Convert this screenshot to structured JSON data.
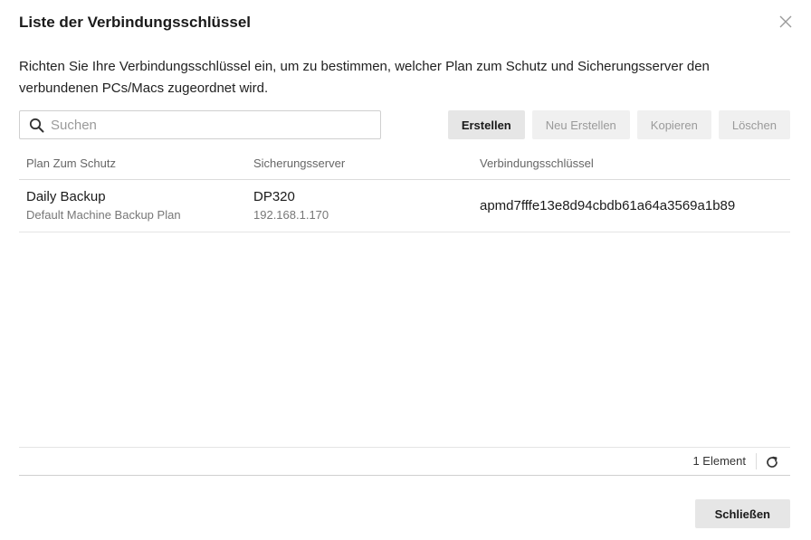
{
  "dialog": {
    "title": "Liste der Verbindungsschlüssel",
    "description": "Richten Sie Ihre Verbindungsschlüssel ein, um zu bestimmen, welcher Plan zum Schutz und Sicherungsserver den verbundenen PCs/Macs zugeordnet wird.",
    "close_icon": "close-icon"
  },
  "search": {
    "placeholder": "Suchen",
    "value": "",
    "icon": "search-icon"
  },
  "toolbar": {
    "create_label": "Erstellen",
    "recreate_label": "Neu Erstellen",
    "copy_label": "Kopieren",
    "delete_label": "Löschen"
  },
  "table": {
    "columns": [
      "Plan Zum Schutz",
      "Sicherungsserver",
      "Verbindungsschlüssel"
    ],
    "rows": [
      {
        "plan": "Daily Backup",
        "plan_sub": "Default Machine Backup Plan",
        "server": "DP320",
        "server_sub": "192.168.1.170",
        "key": "apmd7fffe13e8d94cbdb61a64a3569a1b89"
      }
    ]
  },
  "footer": {
    "count": "1 Element",
    "refresh_icon": "refresh-icon",
    "close_label": "Schließen"
  }
}
